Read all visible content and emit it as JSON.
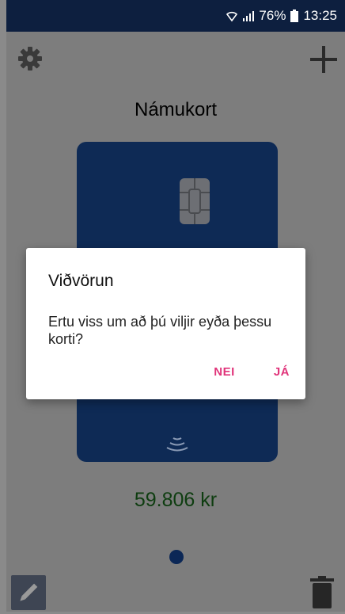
{
  "status_bar": {
    "battery": "76%",
    "time": "13:25",
    "icons": [
      "wifi-icon",
      "signal-icon",
      "battery-icon"
    ]
  },
  "toolbar": {
    "settings_icon": "gear-icon",
    "add_icon": "plus-icon"
  },
  "card": {
    "title": "Námukort",
    "balance": "59.806 kr"
  },
  "bottom_bar": {
    "edit_icon": "pencil-icon",
    "delete_icon": "trash-icon"
  },
  "dialog": {
    "title": "Viðvörun",
    "message": "Ertu viss um að þú viljir eyða þessu korti?",
    "negative_label": "NEI",
    "positive_label": "JÁ"
  },
  "colors": {
    "accent": "#e0347a",
    "card": "#0e2a55",
    "balance": "#0e3d10"
  }
}
